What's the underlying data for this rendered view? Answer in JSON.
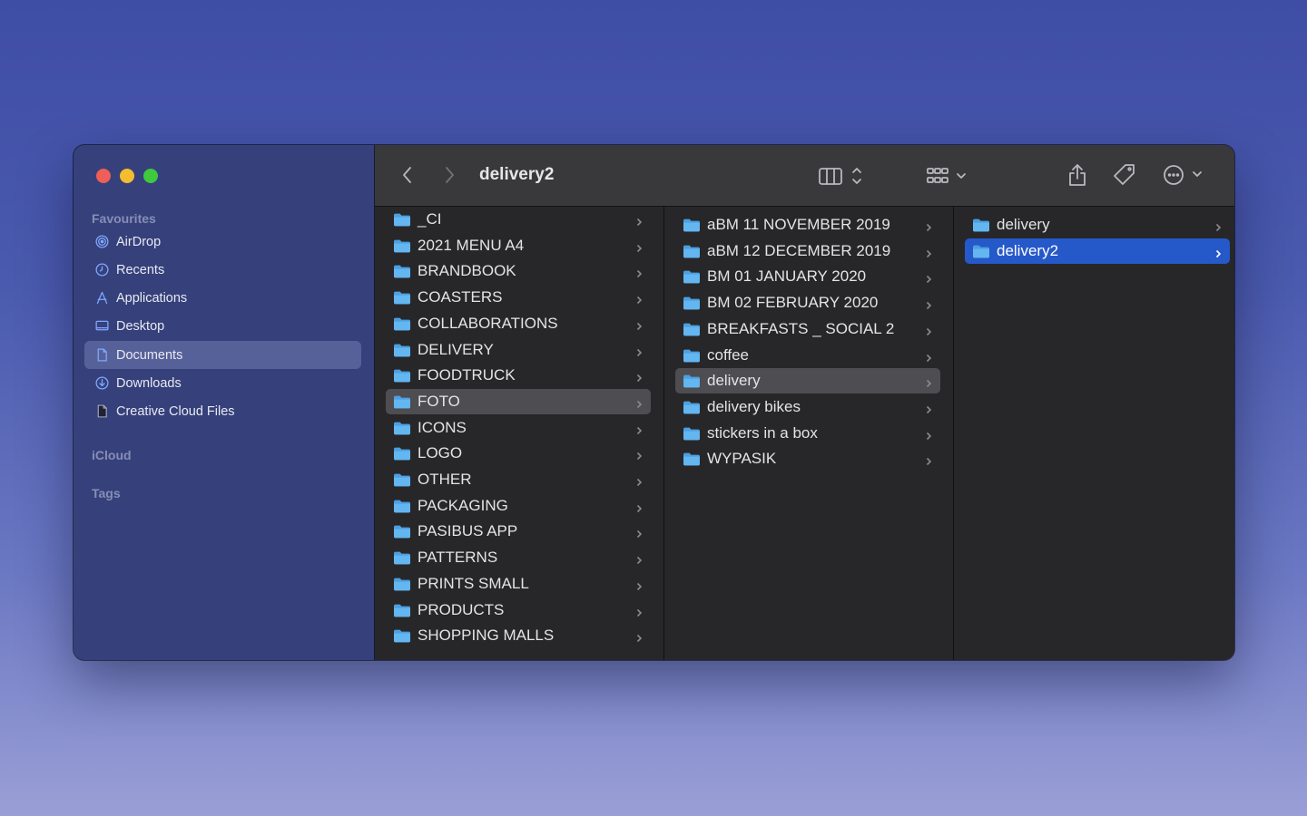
{
  "window": {
    "title": "delivery2"
  },
  "sidebar": {
    "favourites_heading": "Favourites",
    "icloud_heading": "iCloud",
    "tags_heading": "Tags",
    "items": [
      {
        "label": "AirDrop",
        "icon": "airdrop-icon"
      },
      {
        "label": "Recents",
        "icon": "clock-icon"
      },
      {
        "label": "Applications",
        "icon": "applications-icon"
      },
      {
        "label": "Desktop",
        "icon": "desktop-icon"
      },
      {
        "label": "Documents",
        "icon": "document-icon",
        "selected": true
      },
      {
        "label": "Downloads",
        "icon": "download-icon"
      },
      {
        "label": "Creative Cloud Files",
        "icon": "file-icon"
      }
    ]
  },
  "toolbar": {
    "back_icon": "chevron-left-icon",
    "forward_icon": "chevron-right-icon",
    "view_icon": "columns-view-icon",
    "group_icon": "grid-icon",
    "share_icon": "share-icon",
    "tag_icon": "tag-icon",
    "more_icon": "ellipsis-circle-icon",
    "search_icon": "search-icon"
  },
  "columns": {
    "col1": [
      "_CI",
      "2021 MENU A4",
      "BRANDBOOK",
      "COASTERS",
      "COLLABORATIONS",
      "DELIVERY",
      "FOODTRUCK",
      "FOTO",
      "ICONS",
      "LOGO",
      "OTHER",
      "PACKAGING",
      "PASIBUS APP",
      "PATTERNS",
      "PRINTS SMALL",
      "PRODUCTS",
      "SHOPPING MALLS"
    ],
    "col1_selected": "FOTO",
    "col2": [
      "aBM 11 NOVEMBER 2019",
      "aBM 12 DECEMBER 2019",
      "BM 01 JANUARY 2020",
      "BM 02 FEBRUARY 2020",
      "BREAKFASTS _ SOCIAL 2",
      "coffee",
      "delivery",
      "delivery bikes",
      "stickers in a box",
      "WYPASIK"
    ],
    "col2_selected": "delivery",
    "col3": [
      "delivery",
      "delivery2"
    ],
    "col3_selected": "delivery2"
  },
  "colors": {
    "accent_blue": "#2559c9",
    "folder_blue": "#5fb3ee",
    "close": "#ed5f57",
    "minimize": "#f4bd2f",
    "zoom": "#3ec93f"
  }
}
